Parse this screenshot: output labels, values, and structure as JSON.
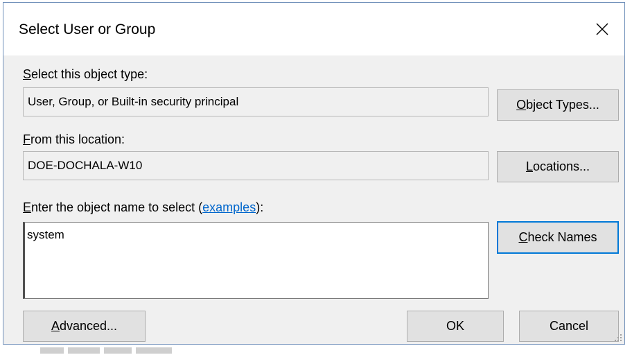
{
  "dialog": {
    "title": "Select User or Group"
  },
  "object_type": {
    "label_accel": "S",
    "label_rest": "elect this object type:",
    "value": "User, Group, or Built-in security principal",
    "button_accel": "O",
    "button_rest": "bject Types..."
  },
  "location": {
    "label_accel": "F",
    "label_rest": "rom this location:",
    "value": "DOE-DOCHALA-W10",
    "button_accel": "L",
    "button_rest": "ocations..."
  },
  "object_name": {
    "label_accel": "E",
    "label_rest": "nter the object name to select (",
    "link": "examples",
    "label_end": "):",
    "value": "system",
    "button_accel": "C",
    "button_rest": "heck Names"
  },
  "footer": {
    "advanced_accel": "A",
    "advanced_rest": "dvanced...",
    "ok": "OK",
    "cancel": "Cancel"
  },
  "colors": {
    "accent": "#0078d7",
    "link": "#0066cc",
    "dialog_bg": "#f0f0f0"
  },
  "icons": {
    "close": "close-icon",
    "resize": "resize-grip-icon"
  }
}
